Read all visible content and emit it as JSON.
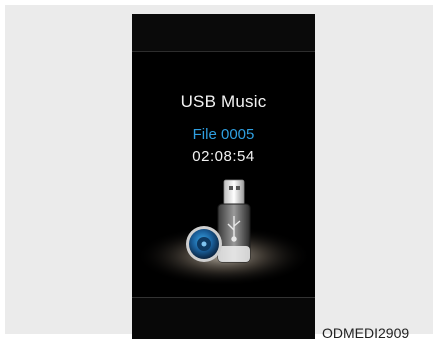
{
  "screen": {
    "title": "USB Music",
    "file_label": "File 0005",
    "elapsed_time": "02:08:54",
    "accent_color": "#2f9fe0",
    "illustration": [
      "usb-drive-icon",
      "music-disc-icon",
      "usb-symbol-icon"
    ]
  },
  "caption": "ODMEDI2909"
}
